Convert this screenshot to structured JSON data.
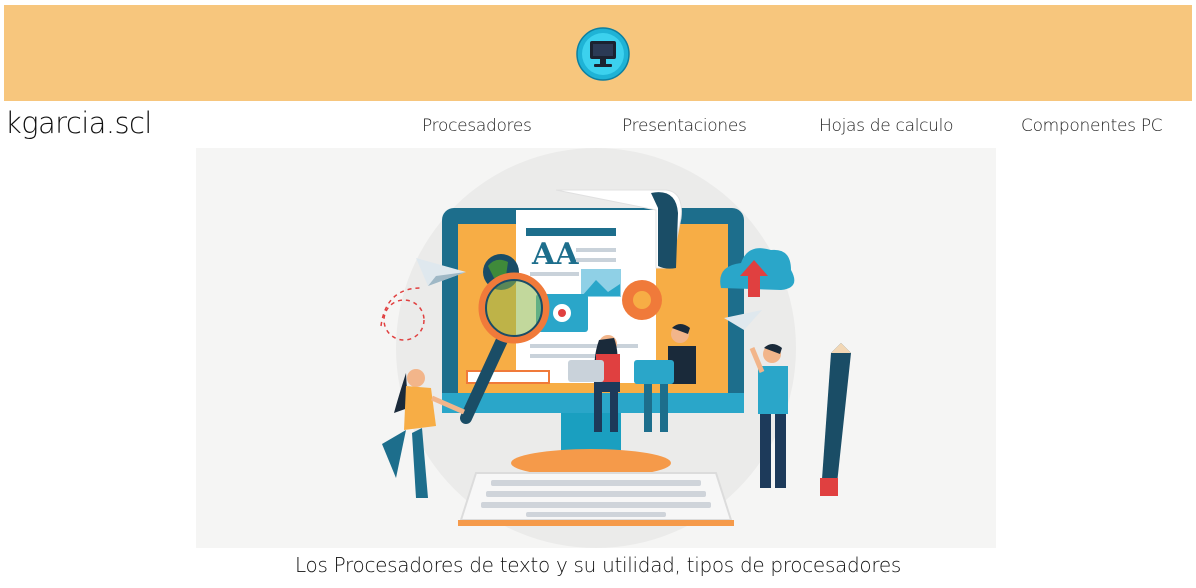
{
  "header": {
    "logo_icon": "monitor-icon",
    "banner_color": "#f7c67d"
  },
  "brand": {
    "name": "kgarcia.scl"
  },
  "nav": {
    "items": [
      {
        "label": "Procesadores"
      },
      {
        "label": "Presentaciones"
      },
      {
        "label": "Hojas de calculo"
      },
      {
        "label": "Componentes PC"
      }
    ]
  },
  "hero": {
    "illustration": "computer-illustration",
    "doc_letters": "AA"
  },
  "caption": {
    "text": "Los Procesadores de texto y su utilidad, tipos de procesadores"
  }
}
